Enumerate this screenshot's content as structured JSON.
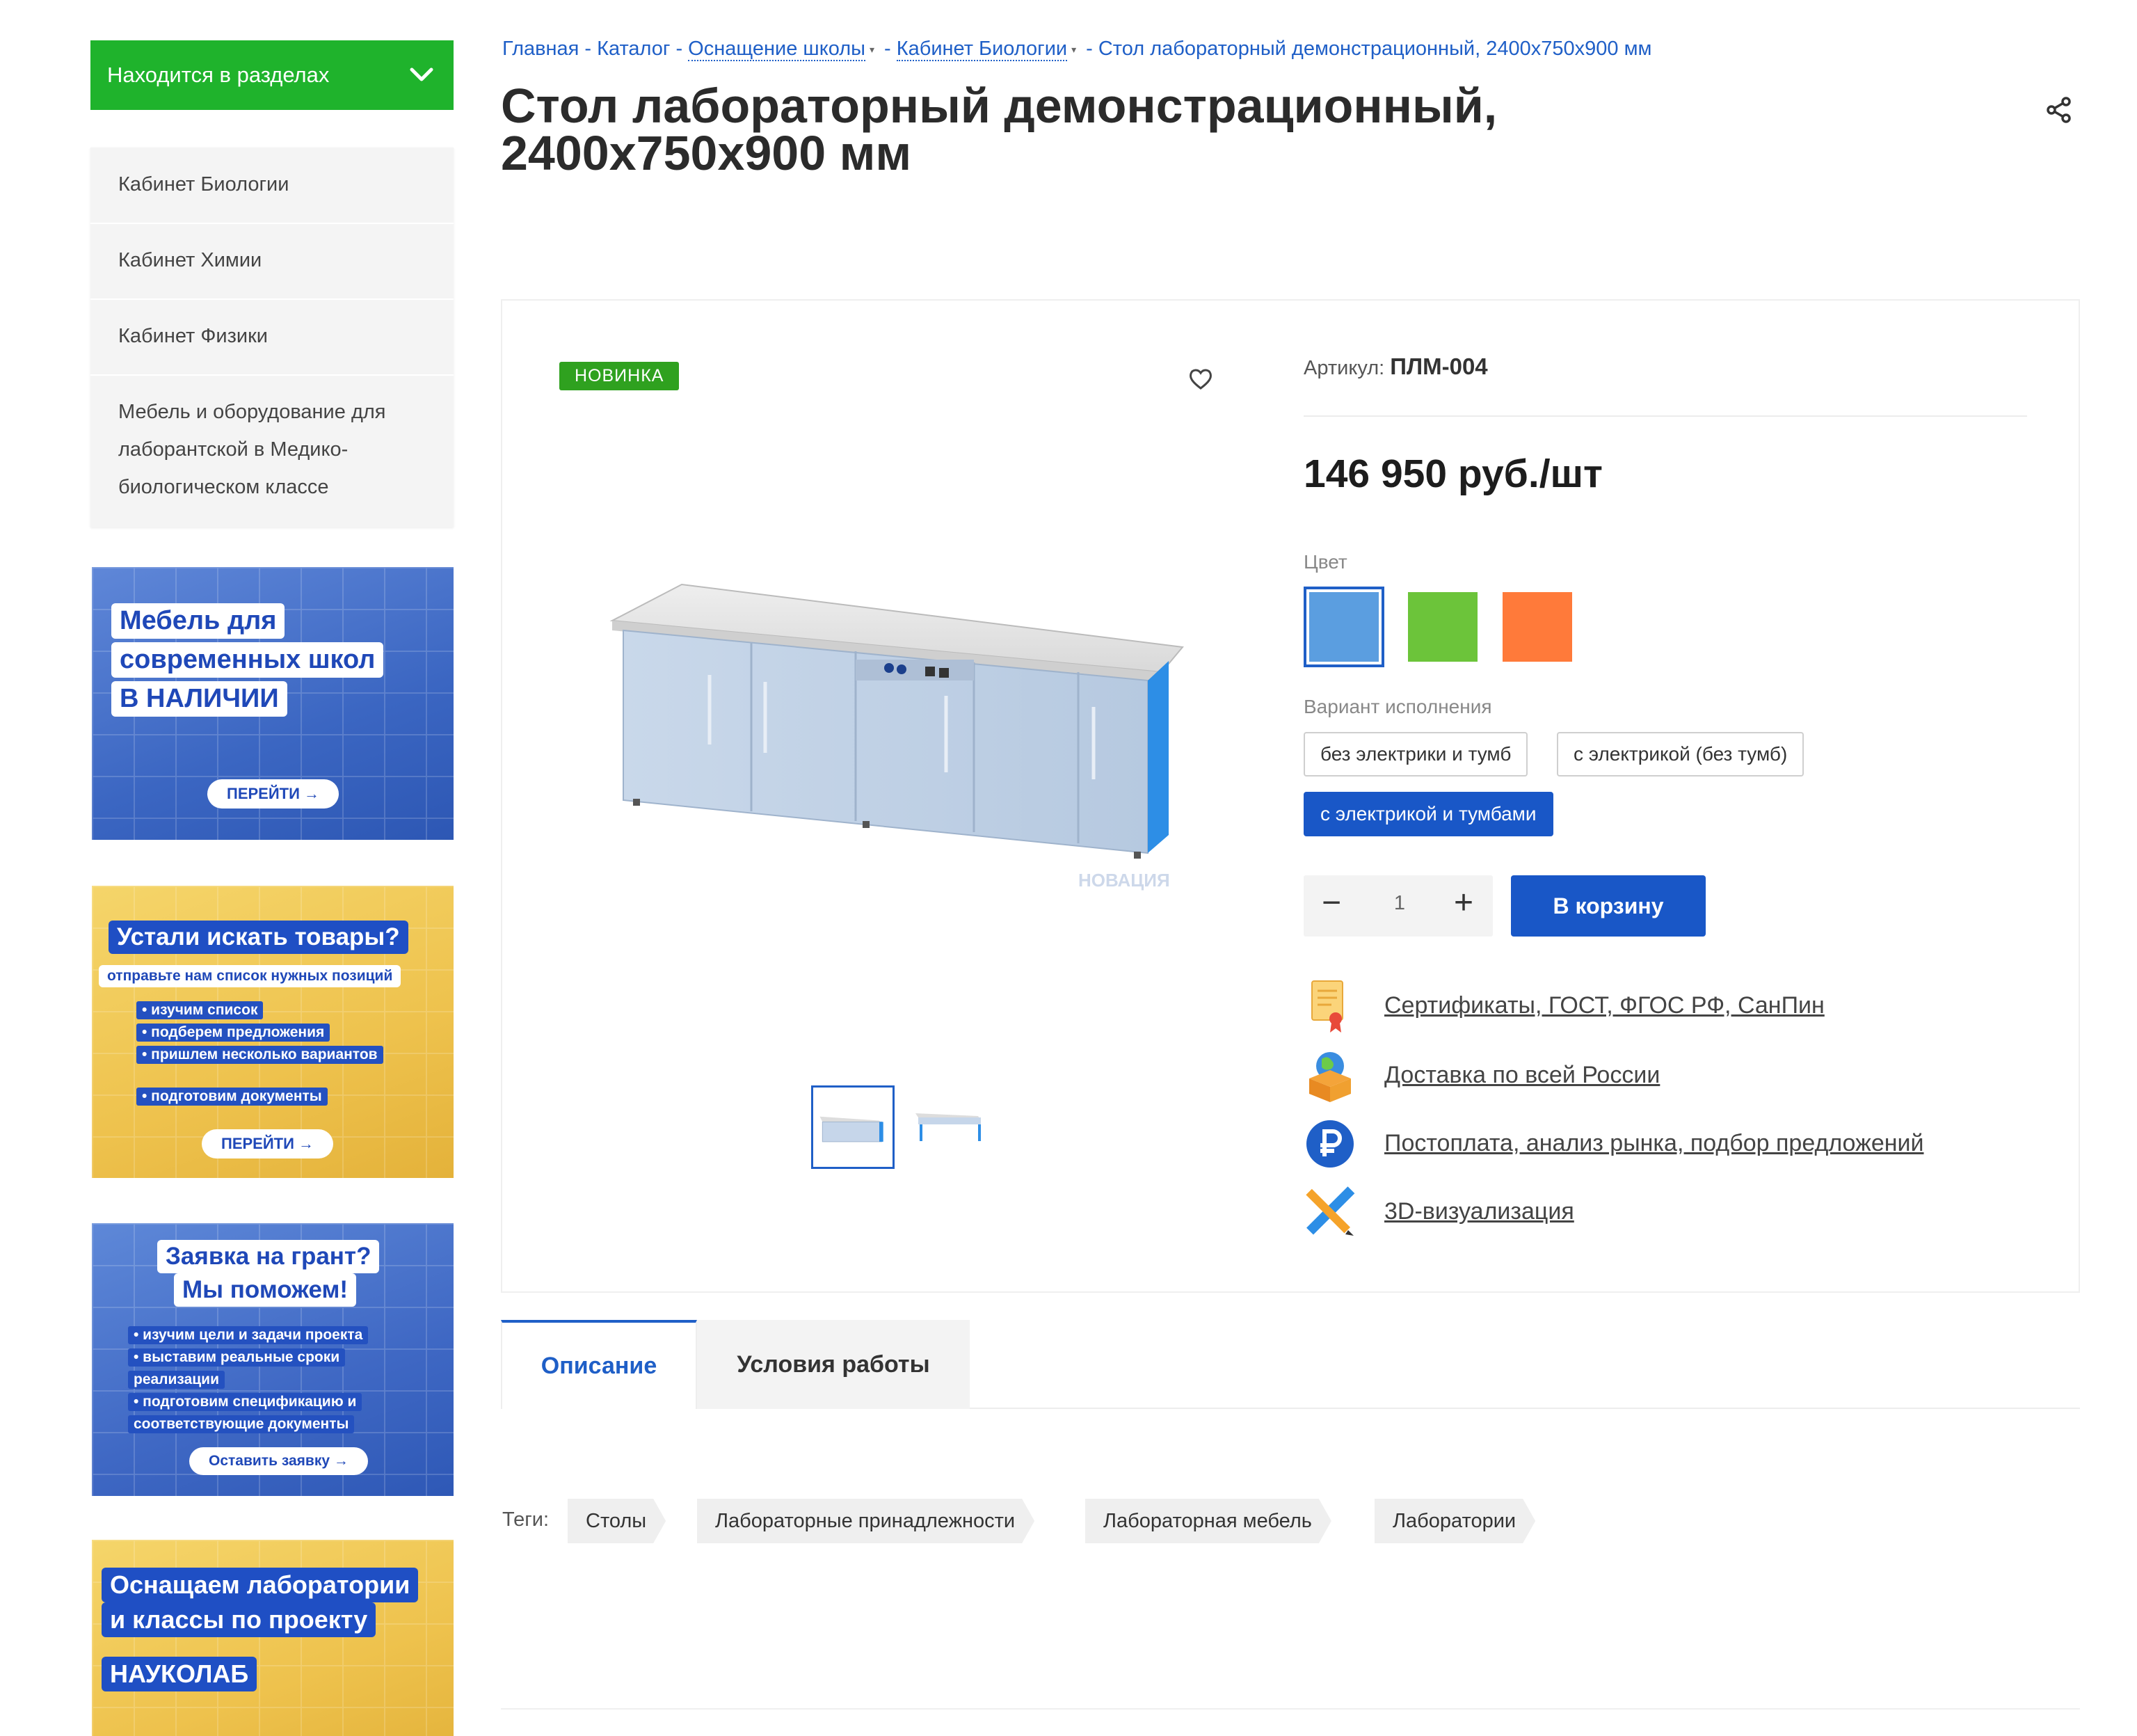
{
  "sidebar": {
    "sections_title": "Находится в разделах",
    "items": [
      {
        "label": "Кабинет Биологии"
      },
      {
        "label": "Кабинет Химии"
      },
      {
        "label": "Кабинет Физики"
      },
      {
        "label": "Мебель и оборудование для лаборантской в Медико-биологическом классе"
      }
    ]
  },
  "banners": {
    "b1": {
      "line1": "Мебель для",
      "line2": "современных школ",
      "line3": "В НАЛИЧИИ",
      "button": "ПЕРЕЙТИ →"
    },
    "b2": {
      "title": "Устали искать товары?",
      "subtitle": "отправьте нам список нужных позиций",
      "bullets": [
        "• изучим список",
        "• подберем предложения",
        "• пришлем несколько вариантов",
        "• подготовим документы"
      ],
      "button": "ПЕРЕЙТИ →"
    },
    "b3": {
      "line1": "Заявка на грант?",
      "line2": "Мы поможем!",
      "bullets": [
        "• изучим цели и задачи проекта",
        "• выставим реальные сроки",
        "  реализации",
        "• подготовим спецификацию и",
        "  соответствующие документы"
      ],
      "button": "Оставить заявку →"
    },
    "b4": {
      "line1": "Оснащаем лаборатории",
      "line2": "и классы по проекту",
      "line3": "НАУКОЛАБ"
    }
  },
  "breadcrumb": {
    "home": "Главная",
    "catalog": "Каталог",
    "school": "Оснащение школы",
    "cabinet": "Кабинет Биологии",
    "current": "Стол лабораторный демонстрационный, 2400х750х900 мм",
    "separator": "-"
  },
  "product": {
    "title_line1": "Стол лабораторный демонстрационный,",
    "title_line2": "2400х750х900 мм",
    "badge": "НОВИНКА",
    "watermark": "НОВАЦИЯ",
    "sku_label": "Артикул:",
    "sku": "ПЛМ-004",
    "price": "146 950 руб./шт",
    "color_label": "Цвет",
    "colors": [
      "#5b9ee0",
      "#6cc43a",
      "#ff7a3a"
    ],
    "variant_label": "Вариант исполнения",
    "variants": [
      "без электрики и тумб",
      "с электрикой (без тумб)",
      "с электрикой и тумбами"
    ],
    "quantity": "1",
    "qty_minus": "−",
    "qty_plus": "+",
    "cart_button": "В корзину",
    "features": [
      {
        "icon": "certificate-icon",
        "label": "Сертификаты, ГОСТ, ФГОС РФ, СанПин"
      },
      {
        "icon": "delivery-box-icon",
        "label": "Доставка по всей России"
      },
      {
        "icon": "ruble-icon",
        "label": "Постоплата, анализ рынка, подбор предложений"
      },
      {
        "icon": "pencil-ruler-icon",
        "label": "3D-визуализация"
      }
    ]
  },
  "tabs": [
    {
      "label": "Описание"
    },
    {
      "label": "Условия работы"
    }
  ],
  "tags": {
    "label": "Теги:",
    "items": [
      "Столы",
      "Лабораторные принадлежности",
      "Лабораторная мебель",
      "Лаборатории"
    ]
  },
  "colors": {
    "accent": "#1957c7",
    "green": "#1fb32c",
    "link": "#1f5fc7"
  }
}
